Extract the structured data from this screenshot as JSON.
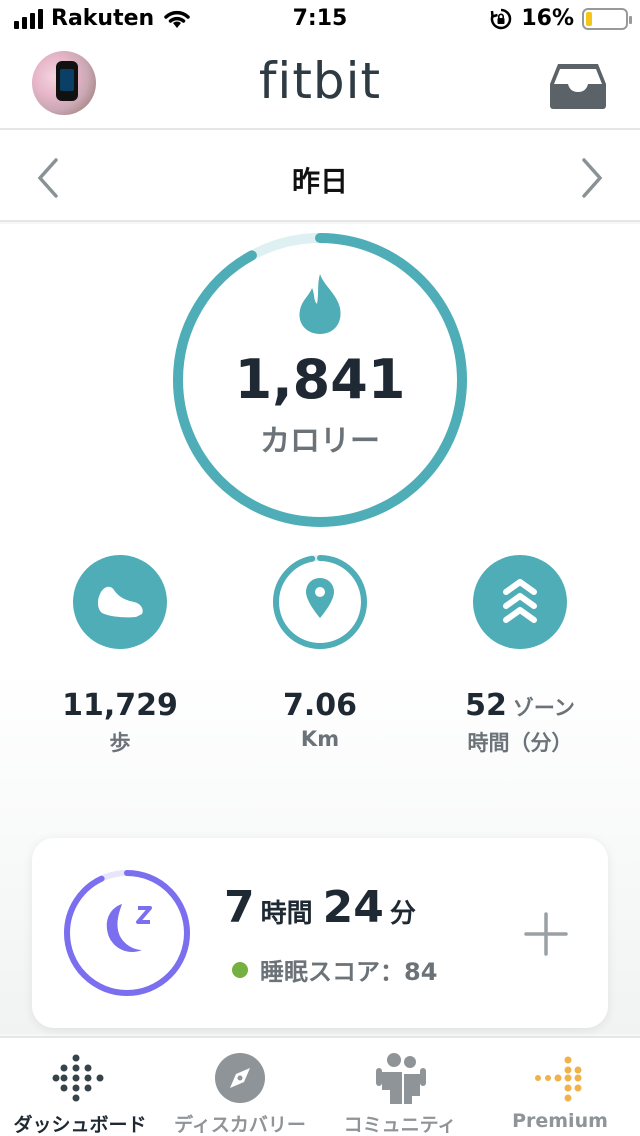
{
  "status_bar": {
    "carrier": "Rakuten",
    "time": "7:15",
    "battery_percent": "16%",
    "battery_level": 0.16
  },
  "header": {
    "logo": "fitbit"
  },
  "date_nav": {
    "title": "昨日"
  },
  "calories": {
    "value": "1,841",
    "label": "カロリー",
    "progress": 0.92,
    "color": "#4eadb6"
  },
  "stats": [
    {
      "value": "11,729",
      "unit": "歩",
      "icon": "shoe-icon",
      "progress": 1.0
    },
    {
      "value": "7.06",
      "unit": "Km",
      "icon": "location-pin-icon",
      "progress": 0.97
    },
    {
      "value": "52",
      "unit_inline": "ゾーン",
      "unit": "時間（分）",
      "icon": "chevrons-up-icon",
      "progress": 1.0
    }
  ],
  "sleep": {
    "hours": "7",
    "hours_label": "時間",
    "minutes": "24",
    "minutes_label": "分",
    "score_label": "睡眠スコア：84",
    "progress": 0.93,
    "color": "#7b6ff0"
  },
  "tabs": [
    {
      "label": "ダッシュボード",
      "icon": "dots-grid-icon"
    },
    {
      "label": "ディスカバリー",
      "icon": "compass-icon"
    },
    {
      "label": "コミュニティ",
      "icon": "people-icon"
    },
    {
      "label": "Premium",
      "icon": "premium-dots-icon"
    }
  ]
}
